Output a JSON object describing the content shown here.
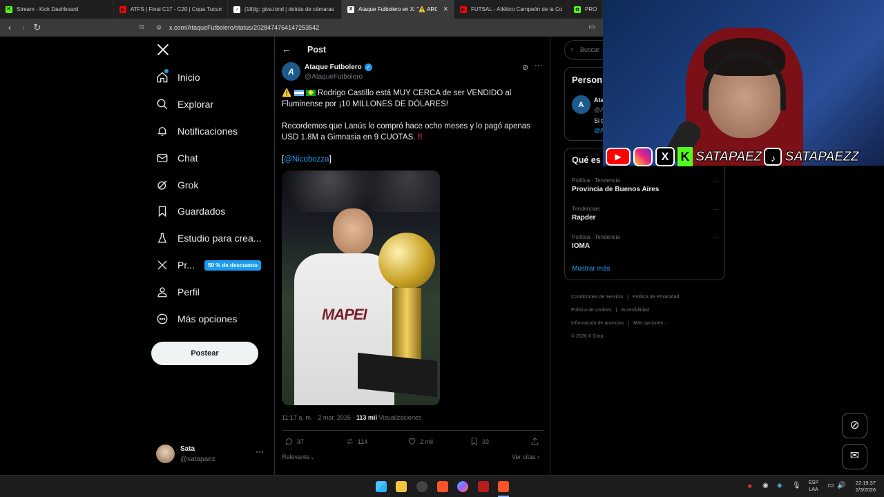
{
  "browser": {
    "tabs": [
      {
        "title": "Stream - Kick Dashboard",
        "color": "#53fc18",
        "glyph": "K"
      },
      {
        "title": "ATFS | Final C17 - C20 | Copa Tucumá",
        "color": "#ff0000",
        "glyph": "▶"
      },
      {
        "title": "(18)lg: giva.lond | detrás de cámaras",
        "color": "#ffffff",
        "glyph": "♪"
      },
      {
        "title": "Ataque Futbolero en X: \"⚠️ ARG",
        "color": "#ffffff",
        "glyph": "X",
        "active": true
      },
      {
        "title": "FUTSAL - Atlético Campeón de la Co",
        "color": "#ff0000",
        "glyph": "▶"
      },
      {
        "title": "PROMIE",
        "color": "#53fc18",
        "glyph": "✿"
      }
    ],
    "url": "x.com/AtaqueFutbolero/status/2028474764147253542"
  },
  "nav": {
    "items": [
      {
        "label": "Inicio",
        "icon": "home-icon"
      },
      {
        "label": "Explorar",
        "icon": "search-icon"
      },
      {
        "label": "Notificaciones",
        "icon": "bell-icon"
      },
      {
        "label": "Chat",
        "icon": "mail-icon"
      },
      {
        "label": "Grok",
        "icon": "grok-icon"
      },
      {
        "label": "Guardados",
        "icon": "bookmark-icon"
      },
      {
        "label": "Estudio para crea...",
        "icon": "flask-icon"
      },
      {
        "label": "Pr...",
        "icon": "x-logo-icon"
      },
      {
        "label": "Perfil",
        "icon": "person-icon"
      },
      {
        "label": "Más opciones",
        "icon": "more-circle-icon"
      }
    ],
    "premium_badge": "50 % de descuento",
    "post_button": "Postear",
    "account": {
      "name": "Sata",
      "handle": "@satapaez"
    }
  },
  "post": {
    "header": "Post",
    "author": "Ataque Futbolero",
    "handle": "@AtaqueFutbolero",
    "line1": "Rodrigo Castillo está MUY CERCA de ser VENDIDO al Fluminense por ¡10 MILLONES DE DÓLARES!",
    "line2": "Recordemos que Lanús lo compró hace ocho meses y lo pagó apenas USD 1.8M a Gimnasia en 9 CUOTAS.",
    "mention": "@Nicobozza",
    "image_text": "MAPEI",
    "time": "11:17 a. m. · 2 mar. 2026 ·",
    "views": "113 mil",
    "views_label": "Visualizaciones",
    "stats": {
      "replies": "37",
      "reposts": "114",
      "likes": "2 mil",
      "bookmarks": "33"
    },
    "sort_label": "Relevante",
    "quotes_label": "Ver citas"
  },
  "right": {
    "search_placeholder": "Buscar",
    "suggest_title": "Person",
    "suggest_name": "Ata",
    "suggest_handle": "@A",
    "suggest_bio": "Si t",
    "suggest_link": "@A",
    "trends_title": "Qué es",
    "trends": [
      {
        "category": "Política · Tendencia",
        "name": "Provincia de Buenos Aires"
      },
      {
        "category": "Tendencias",
        "name": "Rapder"
      },
      {
        "category": "Política · Tendencia",
        "name": "IOMA"
      }
    ],
    "show_more": "Mostrar más",
    "footer": [
      "Condiciones de Servicio",
      "Política de Privacidad",
      "Política de cookies",
      "Accesibilidad",
      "Información de anuncios",
      "Más opciones ···"
    ],
    "copyright": "© 2026 X Corp."
  },
  "overlay": {
    "handle1": "SATAPAEZ",
    "handle2": "SATAPAEZZ"
  },
  "taskbar": {
    "lang": "ESP",
    "layout": "LAA",
    "time": "22:19:37",
    "date": "2/3/2026"
  }
}
